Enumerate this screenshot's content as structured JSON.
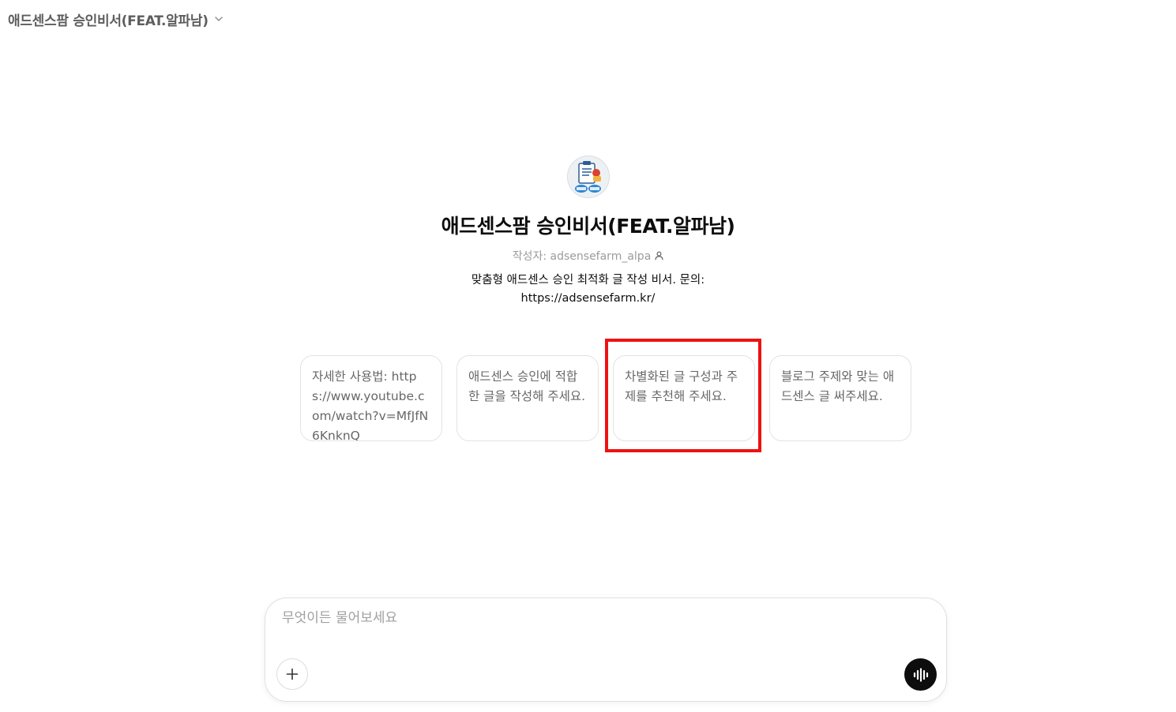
{
  "header": {
    "title": "애드센스팜 승인비서(FEAT.알파남)",
    "chevron_icon": "chevron-down-icon"
  },
  "gpt": {
    "avatar_icon": "gpt-avatar-logo",
    "title": "애드센스팜 승인비서(FEAT.알파남)",
    "author": "작성자: adsensefarm_alpa",
    "author_icon": "person-icon",
    "description": "맞춤형 애드센스 승인 최적화 글 작성 비서. 문의: https://adsensefarm.kr/"
  },
  "suggestions": [
    {
      "text": "자세한 사용법: https://www.youtube.com/watch?v=MfJfN6KnknQ"
    },
    {
      "text": "애드센스 승인에 적합한 글을 작성해 주세요."
    },
    {
      "text": "차별화된 글 구성과 주제를 추천해 주세요."
    },
    {
      "text": "블로그 주제와 맞는 애드센스 글 써주세요."
    }
  ],
  "highlight": {
    "color": "#ee1111",
    "target": "suggestion-card-3"
  },
  "composer": {
    "placeholder": "무엇이든 물어보세요",
    "value": "",
    "add_icon": "plus-icon",
    "voice_icon": "voice-mode-icon"
  }
}
